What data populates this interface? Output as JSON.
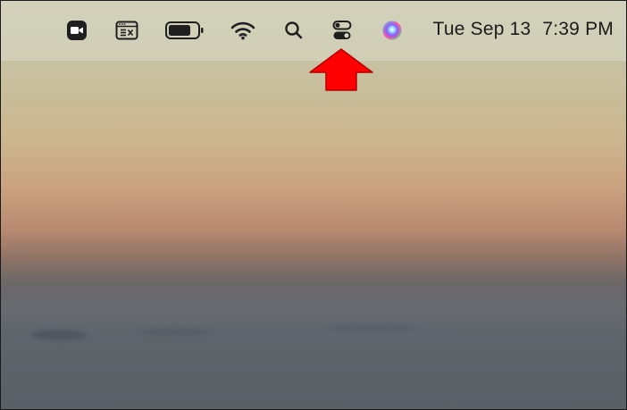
{
  "menubar": {
    "items": [
      {
        "icon": "zoom-video-icon"
      },
      {
        "icon": "menu-extra-window-icon"
      },
      {
        "icon": "battery-icon"
      },
      {
        "icon": "wifi-icon"
      },
      {
        "icon": "spotlight-search-icon"
      },
      {
        "icon": "control-center-icon"
      },
      {
        "icon": "siri-icon"
      }
    ],
    "date": "Tue Sep 13",
    "time": "7:39 PM"
  },
  "annotation": {
    "type": "arrow",
    "points_to": "control-center-icon",
    "color": "#ff0000"
  }
}
